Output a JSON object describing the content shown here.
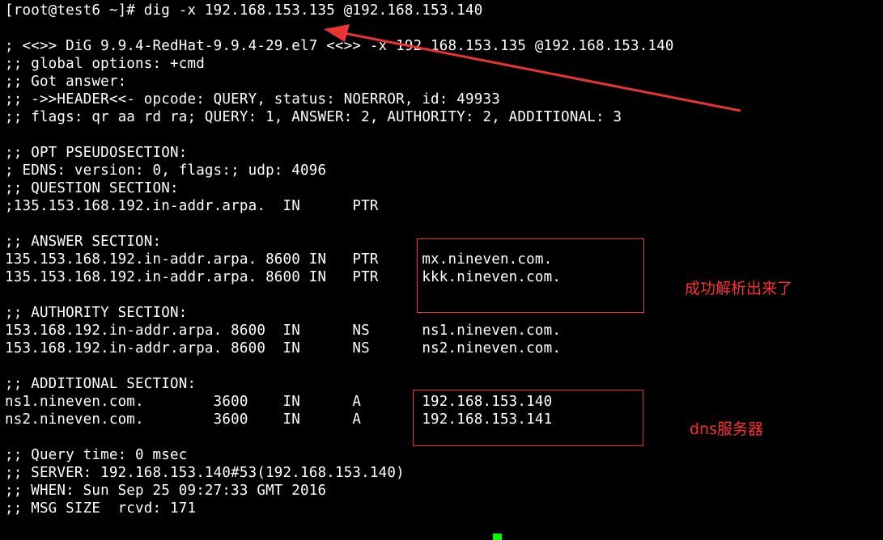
{
  "terminal": {
    "lines": [
      "[root@test6 ~]# dig -x 192.168.153.135 @192.168.153.140",
      "",
      "; <<>> DiG 9.9.4-RedHat-9.9.4-29.el7 <<>> -x 192.168.153.135 @192.168.153.140",
      ";; global options: +cmd",
      ";; Got answer:",
      ";; ->>HEADER<<- opcode: QUERY, status: NOERROR, id: 49933",
      ";; flags: qr aa rd ra; QUERY: 1, ANSWER: 2, AUTHORITY: 2, ADDITIONAL: 3",
      "",
      ";; OPT PSEUDOSECTION:",
      "; EDNS: version: 0, flags:; udp: 4096",
      ";; QUESTION SECTION:",
      ";135.153.168.192.in-addr.arpa.  IN      PTR",
      "",
      ";; ANSWER SECTION:",
      "135.153.168.192.in-addr.arpa. 8600 IN   PTR     mx.nineven.com.",
      "135.153.168.192.in-addr.arpa. 8600 IN   PTR     kkk.nineven.com.",
      "",
      ";; AUTHORITY SECTION:",
      "153.168.192.in-addr.arpa. 8600  IN      NS      ns1.nineven.com.",
      "153.168.192.in-addr.arpa. 8600  IN      NS      ns2.nineven.com.",
      "",
      ";; ADDITIONAL SECTION:",
      "ns1.nineven.com.        3600    IN      A       192.168.153.140",
      "ns2.nineven.com.        3600    IN      A       192.168.153.141",
      "",
      ";; Query time: 0 msec",
      ";; SERVER: 192.168.153.140#53(192.168.153.140)",
      ";; WHEN: Sun Sep 25 09:27:33 GMT 2016",
      ";; MSG SIZE  rcvd: 171"
    ]
  },
  "annotations": {
    "answer_note": "成功解析出来了",
    "additional_note": "dns服务器",
    "color": "#e83434"
  },
  "colors": {
    "background": "#000000",
    "text": "#ffffff",
    "cursor": "#00ff00"
  }
}
